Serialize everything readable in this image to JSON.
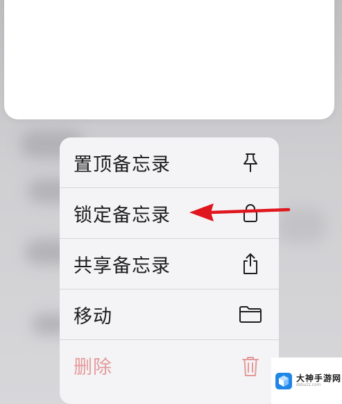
{
  "menu": {
    "items": [
      {
        "label": "置顶备忘录",
        "icon": "pin-icon",
        "destructive": false
      },
      {
        "label": "锁定备忘录",
        "icon": "lock-icon",
        "destructive": false
      },
      {
        "label": "共享备忘录",
        "icon": "share-icon",
        "destructive": false
      },
      {
        "label": "移动",
        "icon": "folder-icon",
        "destructive": false
      },
      {
        "label": "删除",
        "icon": "trash-icon",
        "destructive": true
      }
    ]
  },
  "annotation": {
    "arrow_color": "#e0161e",
    "arrow_target": "锁定备忘录"
  },
  "watermark": {
    "title": "大神手游网",
    "url": "dsbuzz.com"
  },
  "colors": {
    "menu_background": "#f4f4f6",
    "destructive_text": "#e59a9a",
    "icon_color": "#1c1c1e"
  }
}
